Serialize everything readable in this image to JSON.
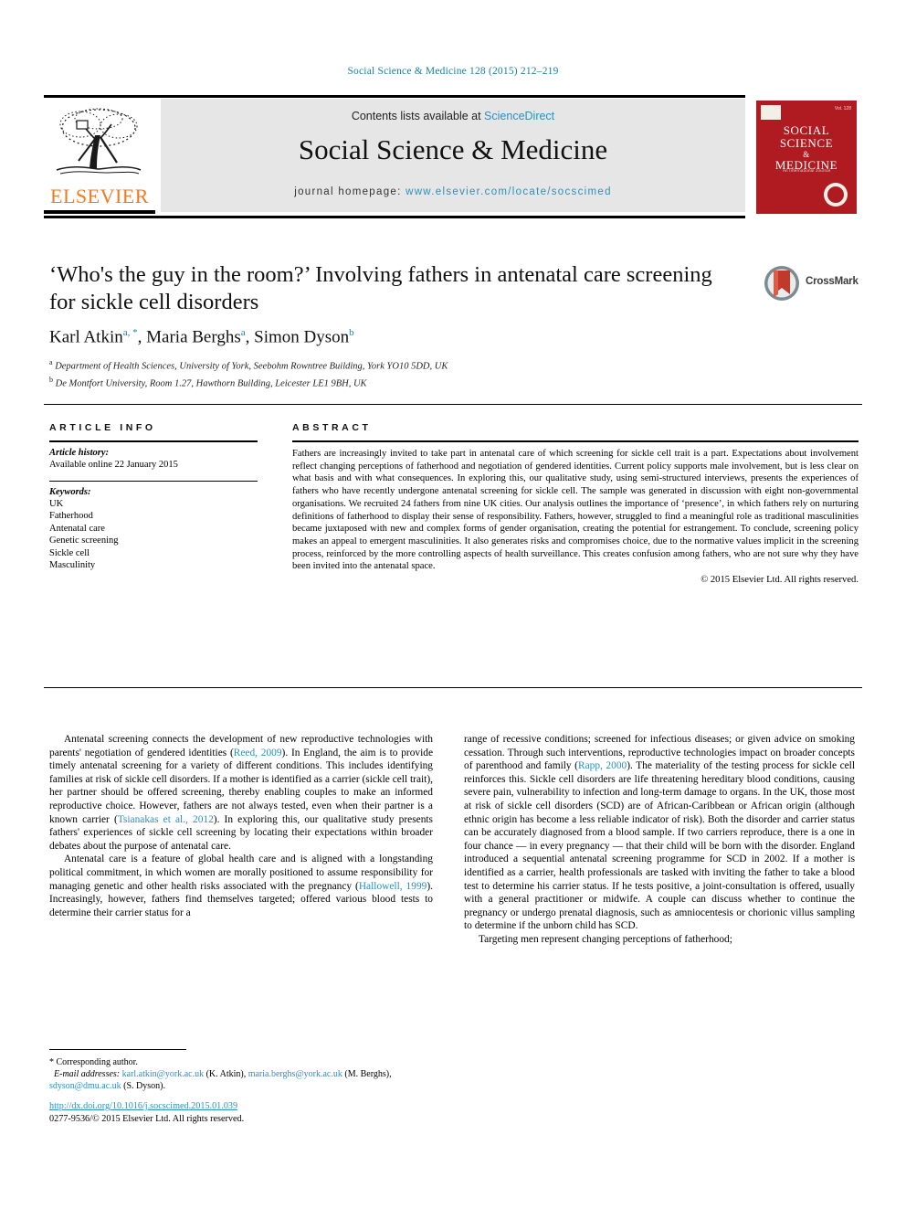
{
  "running_head": "Social Science & Medicine 128 (2015) 212–219",
  "banner": {
    "contents_prefix": "Contents lists available at ",
    "sciencedirect": "ScienceDirect",
    "journal_name": "Social Science & Medicine",
    "homepage_label": "journal homepage:",
    "homepage_url": "www.elsevier.com/locate/socscimed",
    "publisher": "ELSEVIER",
    "link_color": "#2a8fc4"
  },
  "cover": {
    "title_line1": "SOCIAL",
    "title_line2": "SCIENCE",
    "amp": "&",
    "title_line3": "MEDICINE",
    "subtitle": "An International Journal",
    "issue_text": "Vol. 128",
    "bg_color": "#b01a21"
  },
  "article": {
    "title": "‘Who's the guy in the room?’ Involving fathers in antenatal care screening for sickle cell disorders",
    "authors": [
      {
        "name": "Karl Atkin",
        "marks": "a, *"
      },
      {
        "name": "Maria Berghs",
        "marks": "a"
      },
      {
        "name": "Simon Dyson",
        "marks": "b"
      }
    ],
    "affiliations": [
      {
        "mark": "a",
        "text": "Department of Health Sciences, University of York, Seebohm Rowntree Building, York YO10 5DD, UK"
      },
      {
        "mark": "b",
        "text": "De Montfort University, Room 1.27, Hawthorn Building, Leicester LE1 9BH, UK"
      }
    ],
    "crossmark_label": "CrossMark"
  },
  "article_info": {
    "heading": "ARTICLE INFO",
    "history_label": "Article history:",
    "history_value": "Available online 22 January 2015",
    "keywords_label": "Keywords:",
    "keywords": [
      "UK",
      "Fatherhood",
      "Antenatal care",
      "Genetic screening",
      "Sickle cell",
      "Masculinity"
    ]
  },
  "abstract": {
    "heading": "ABSTRACT",
    "text": "Fathers are increasingly invited to take part in antenatal care of which screening for sickle cell trait is a part. Expectations about involvement reflect changing perceptions of fatherhood and negotiation of gendered identities. Current policy supports male involvement, but is less clear on what basis and with what consequences. In exploring this, our qualitative study, using semi-structured interviews, presents the experiences of fathers who have recently undergone antenatal screening for sickle cell. The sample was generated in discussion with eight non-governmental organisations. We recruited 24 fathers from nine UK cities. Our analysis outlines the importance of ‘presence’, in which fathers rely on nurturing definitions of fatherhood to display their sense of responsibility. Fathers, however, struggled to find a meaningful role as traditional masculinities became juxtaposed with new and complex forms of gender organisation, creating the potential for estrangement. To conclude, screening policy makes an appeal to emergent masculinities. It also generates risks and compromises choice, due to the normative values implicit in the screening process, reinforced by the more controlling aspects of health surveillance. This creates confusion among fathers, who are not sure why they have been invited into the antenatal space.",
    "copyright": "© 2015 Elsevier Ltd. All rights reserved."
  },
  "body": {
    "left": {
      "p1_a": "Antenatal screening connects the development of new reproductive technologies with parents' negotiation of gendered identities (",
      "p1_cite1": "Reed, 2009",
      "p1_b": "). In England, the aim is to provide timely antenatal screening for a variety of different conditions. This includes identifying families at risk of sickle cell disorders. If a mother is identified as a carrier (sickle cell trait), her partner should be offered screening, thereby enabling couples to make an informed reproductive choice. However, fathers are not always tested, even when their partner is a known carrier (",
      "p1_cite2": "Tsianakas et al., 2012",
      "p1_c": "). In exploring this, our qualitative study presents fathers' experiences of sickle cell screening by locating their expectations within broader debates about the purpose of antenatal care.",
      "p2_a": "Antenatal care is a feature of global health care and is aligned with a longstanding political commitment, in which women are morally positioned to assume responsibility for managing genetic and other health risks associated with the pregnancy (",
      "p2_cite1": "Hallowell, 1999",
      "p2_b": "). Increasingly, however, fathers find themselves targeted; offered various blood tests to determine their carrier status for a"
    },
    "right": {
      "p1_a": "range of recessive conditions; screened for infectious diseases; or given advice on smoking cessation. Through such interventions, reproductive technologies impact on broader concepts of parenthood and family (",
      "p1_cite1": "Rapp, 2000",
      "p1_b": "). The materiality of the testing process for sickle cell reinforces this. Sickle cell disorders are life threatening hereditary blood conditions, causing severe pain, vulnerability to infection and long-term damage to organs. In the UK, those most at risk of sickle cell disorders (SCD) are of African-Caribbean or African origin (although ethnic origin has become a less reliable indicator of risk). Both the disorder and carrier status can be accurately diagnosed from a blood sample. If two carriers reproduce, there is a one in four chance — in every pregnancy — that their child will be born with the disorder. England introduced a sequential antenatal screening programme for SCD in 2002. If a mother is identified as a carrier, health professionals are tasked with inviting the father to take a blood test to determine his carrier status. If he tests positive, a joint-consultation is offered, usually with a general practitioner or midwife. A couple can discuss whether to continue the pregnancy or undergo prenatal diagnosis, such as amniocentesis or chorionic villus sampling to determine if the unborn child has SCD.",
      "p2": "Targeting men represent changing perceptions of fatherhood;"
    }
  },
  "footnote": {
    "corresponding": "* Corresponding author.",
    "email_label": "E-mail addresses:",
    "emails": [
      {
        "address": "karl.atkin@york.ac.uk",
        "owner": "(K. Atkin)"
      },
      {
        "address": "maria.berghs@york.ac.uk",
        "owner": "(M. Berghs)"
      },
      {
        "address": "sdyson@dmu.ac.uk",
        "owner": "(S. Dyson)"
      }
    ]
  },
  "footer": {
    "doi": "http://dx.doi.org/10.1016/j.socscimed.2015.01.039",
    "issn": "0277-9536/© 2015 Elsevier Ltd. All rights reserved."
  }
}
